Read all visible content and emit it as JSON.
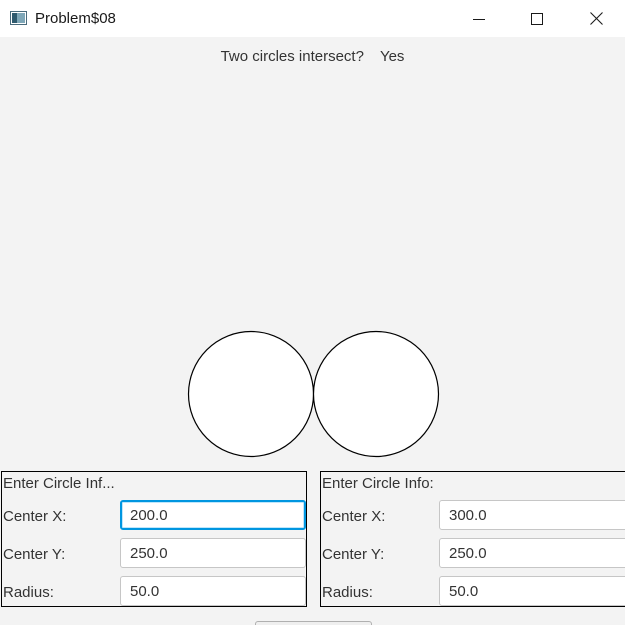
{
  "window": {
    "title": "Problem$08"
  },
  "icons": {
    "app": "application-window-icon",
    "minimize": "minimize-icon",
    "maximize": "maximize-icon",
    "close": "close-icon"
  },
  "status": {
    "question": "Two circles intersect?",
    "answer": "Yes"
  },
  "circle1": {
    "title": "Enter Circle Inf...",
    "center_x_label": "Center X:",
    "center_x": "200.0",
    "center_y_label": "Center Y:",
    "center_y": "250.0",
    "radius_label": "Radius:",
    "radius": "50.0"
  },
  "circle2": {
    "title": "Enter Circle Info:",
    "center_x_label": "Center X:",
    "center_x": "300.0",
    "center_y_label": "Center Y:",
    "center_y": "250.0",
    "radius_label": "Radius:",
    "radius": "50.0"
  },
  "colors": {
    "background": "#f3f3f3",
    "focus_border": "#0096e0",
    "circle_fill": "#ffffff",
    "circle_stroke": "#000000"
  }
}
